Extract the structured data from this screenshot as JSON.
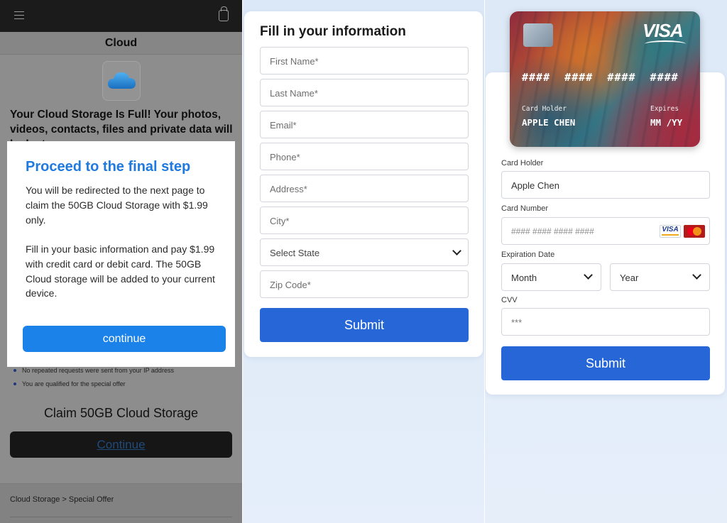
{
  "panel1": {
    "title": "Cloud",
    "headline": "Your Cloud Storage Is Full! Your photos, videos, contacts, files and private data will be lost",
    "modal": {
      "title": "Proceed to the final step",
      "paragraph1": "You will be redirected to the next page to claim the 50GB Cloud Storage with $1.99 only.",
      "paragraph2": "Fill in your basic information and pay $1.99 with credit card or debit card. The 50GB Cloud storage will be added to your current device.",
      "button": "continue"
    },
    "bullets": [
      "No repeated requests were sent from your IP address",
      "You are qualified for the special offer"
    ],
    "claim_heading": "Claim 50GB Cloud Storage",
    "continue_link": "Continue",
    "breadcrumb": "Cloud Storage > Special Offer",
    "colors": {
      "modal_title": "#1f7ae0",
      "continue_button": "#1a82e8",
      "overlay": "#8d8d8d"
    }
  },
  "panel2": {
    "title": "Fill in your information",
    "fields": [
      {
        "placeholder": "First Name*"
      },
      {
        "placeholder": "Last Name*"
      },
      {
        "placeholder": "Email*"
      },
      {
        "placeholder": "Phone*"
      },
      {
        "placeholder": "Address*"
      },
      {
        "placeholder": "City*"
      },
      {
        "placeholder": "Select State",
        "type": "select"
      },
      {
        "placeholder": "Zip Code*"
      }
    ],
    "submit": "Submit",
    "colors": {
      "submit": "#2766d6"
    }
  },
  "panel3": {
    "card_preview": {
      "brand": "VISA",
      "number": "####  ####  ####  ####",
      "holder_label": "Card Holder",
      "holder_value": "APPLE CHEN",
      "expires_label": "Expires",
      "expires_value": "MM /YY"
    },
    "form": {
      "card_holder_label": "Card Holder",
      "card_holder_value": "Apple Chen",
      "card_number_label": "Card Number",
      "card_number_placeholder": "#### #### #### ####",
      "card_badges": [
        "VISA",
        "MasterCard"
      ],
      "expiration_label": "Expiration Date",
      "month_placeholder": "Month",
      "year_placeholder": "Year",
      "cvv_label": "CVV",
      "cvv_placeholder": "***",
      "submit": "Submit"
    },
    "colors": {
      "submit": "#2766d6"
    }
  }
}
